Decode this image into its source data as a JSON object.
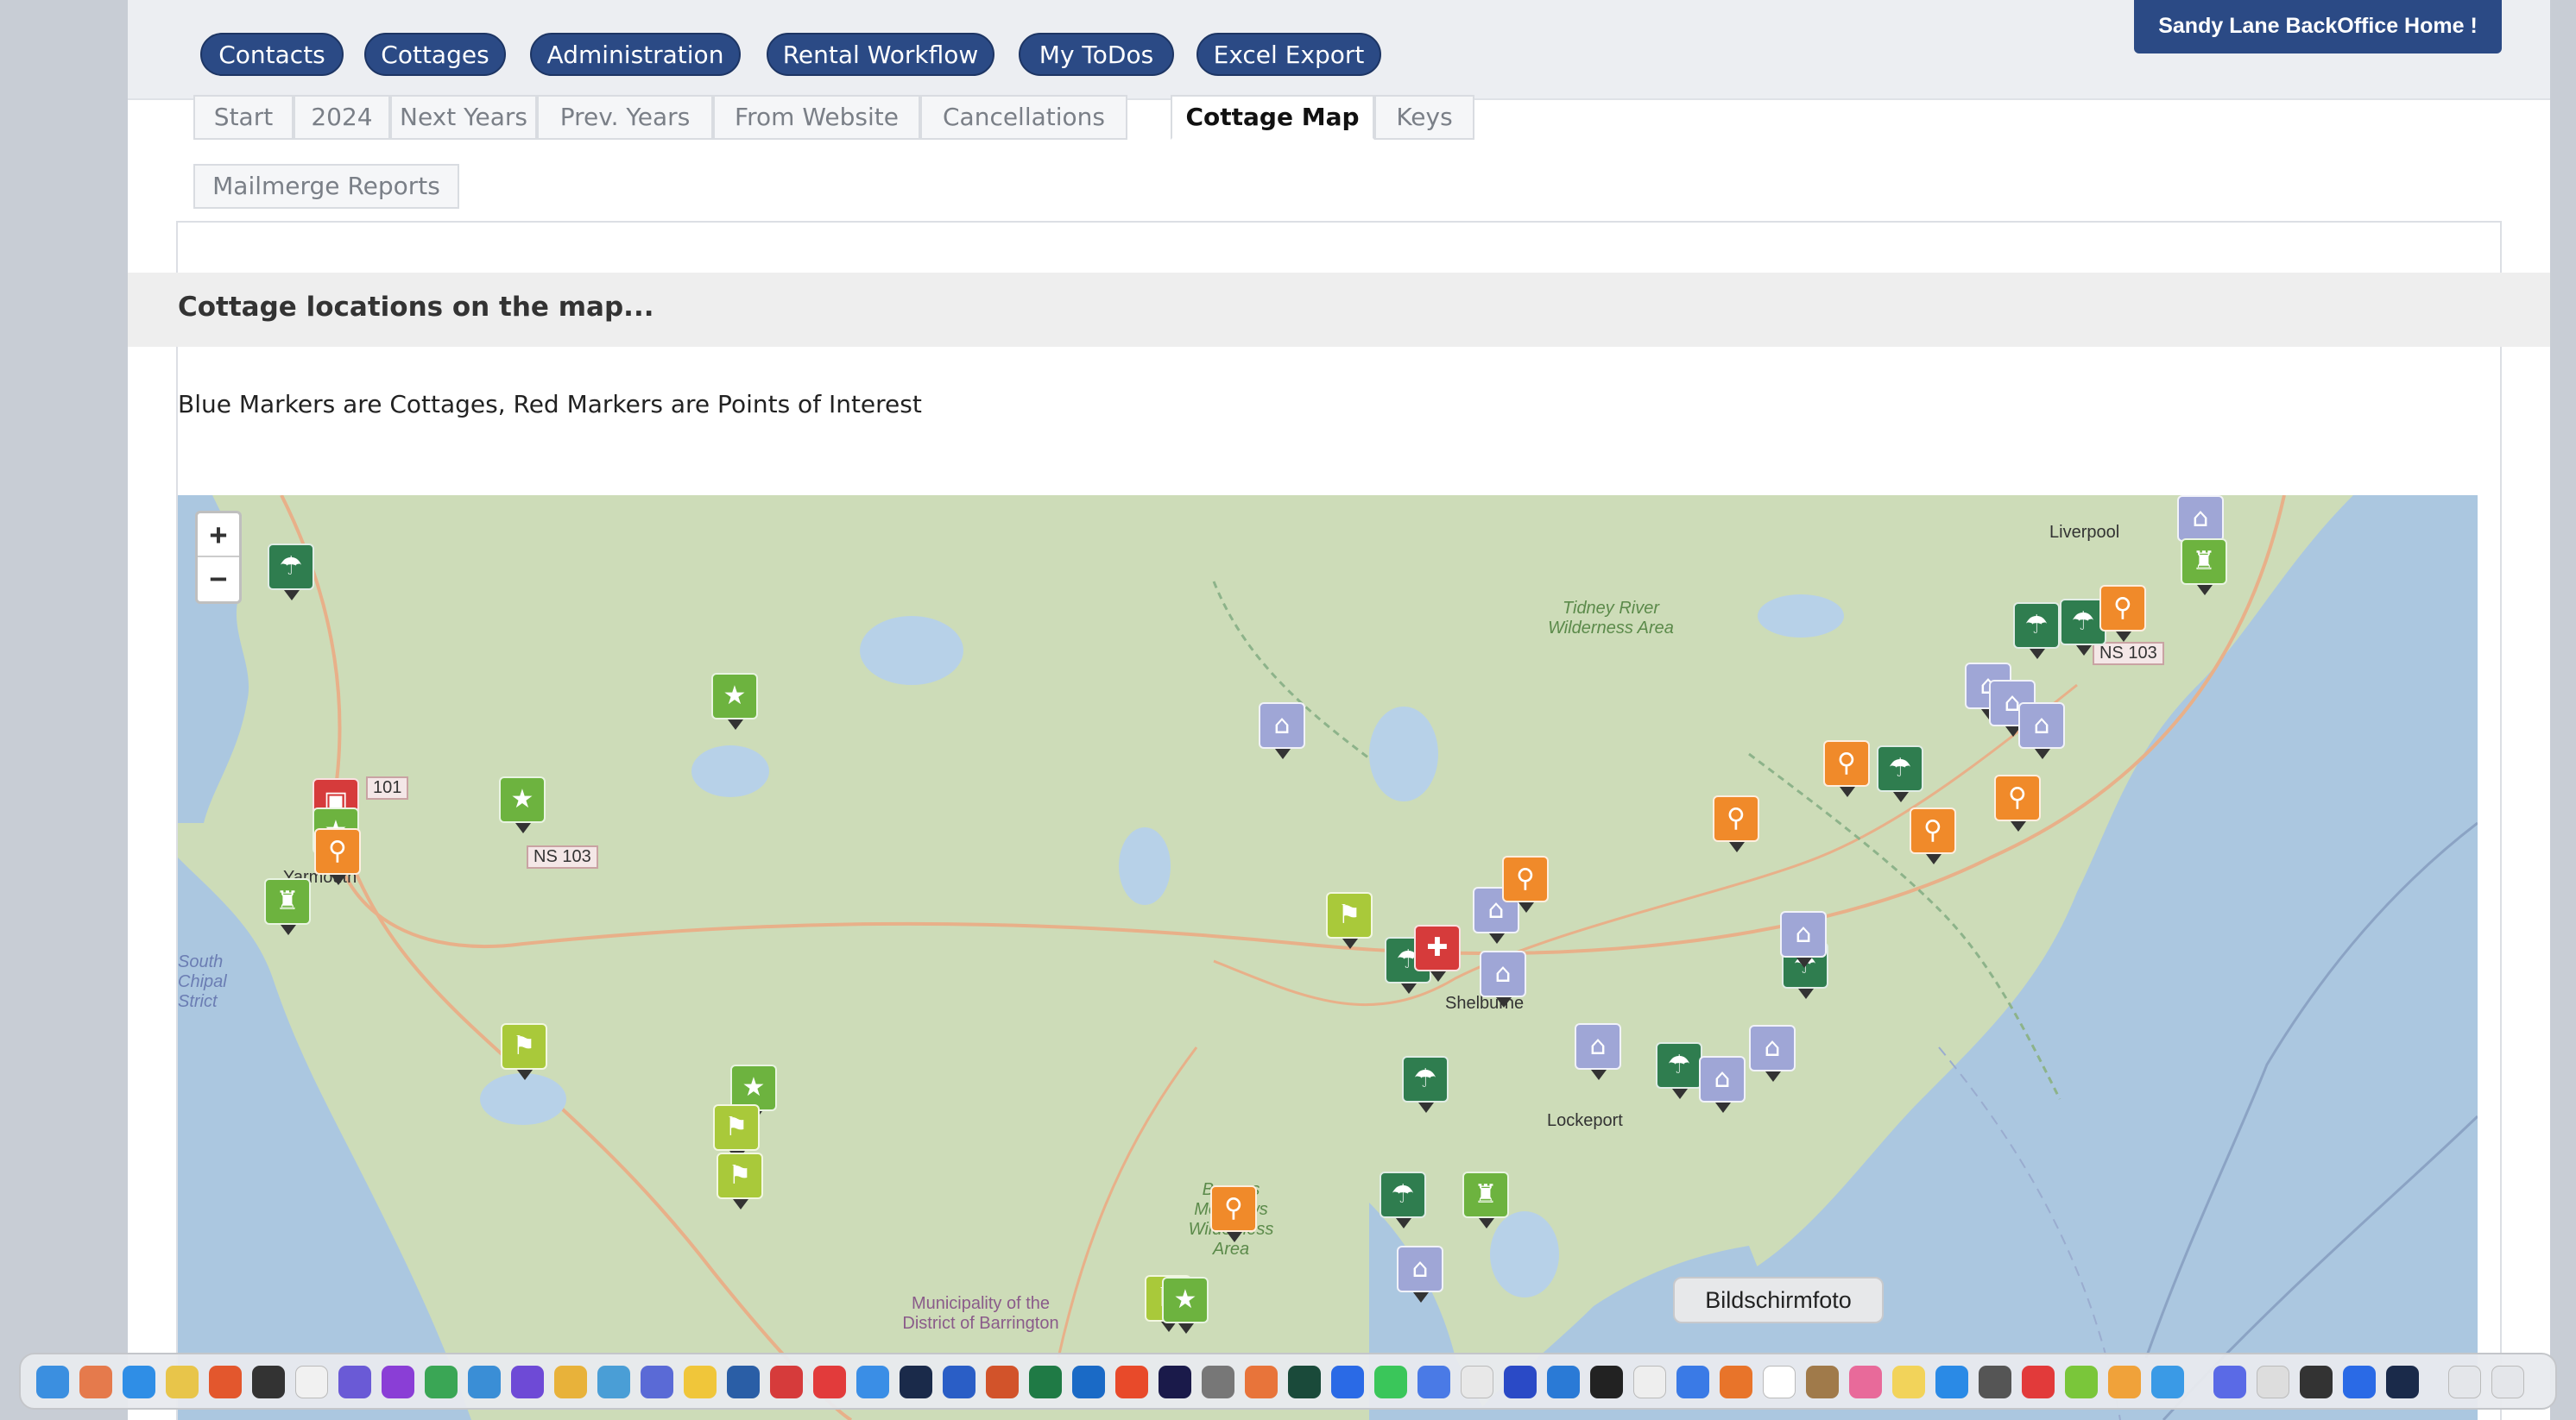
{
  "nav": {
    "buttons": [
      "Contacts",
      "Cottages",
      "Administration",
      "Rental Workflow",
      "My ToDos",
      "Excel Export"
    ],
    "home_label": "Sandy Lane BackOffice Home !"
  },
  "tabs": {
    "items": [
      "Start",
      "2024",
      "Next Years",
      "Prev. Years",
      "From Website",
      "Cancellations",
      "Cottage Map",
      "Keys",
      "Mailmerge Reports"
    ],
    "active": "Cottage Map"
  },
  "section": {
    "title": "Cottage locations on the map...",
    "description": "Blue Markers are Cottages, Red Markers are Points of Interest"
  },
  "map": {
    "zoom_in": "+",
    "zoom_out": "−",
    "place_labels": [
      "Liverpool",
      "Tidney River Wilderness Area",
      "Shelburne",
      "Lockeport",
      "Yarmouth",
      "Bowers Meadows Wilderness Area",
      "Municipality of the District of Barrington",
      "South Chipal Strict"
    ],
    "road_labels": [
      "101",
      "NS 103",
      "NS 103"
    ],
    "marker_colors": {
      "cottage": "#9fa6d6",
      "beach": "#2f7d4f",
      "park": "#6db33f",
      "hiking": "#f08a2a",
      "golf": "#a9c93a",
      "poi": "#d63b3b"
    }
  },
  "tooltip": {
    "text": "Bildschirmfoto"
  }
}
